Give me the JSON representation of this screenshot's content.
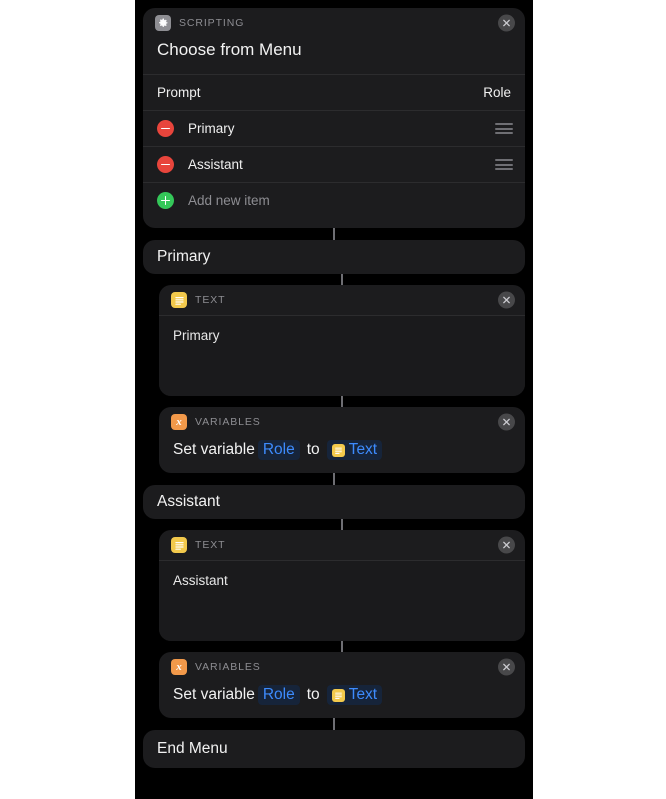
{
  "app": {
    "background": "#000000",
    "page_background": "#ffffff"
  },
  "colors": {
    "card": "#1c1c1e",
    "scripting_icon": "#8e8e93",
    "text_icon": "#f2c94c",
    "variables_icon": "#f2994a",
    "remove": "#e8453c",
    "add": "#34c759",
    "token_text": "#3d8bfd",
    "token_background": "#16243a",
    "separator": "#2c2c2e",
    "connector": "#6e6e73"
  },
  "choose_from_menu": {
    "category": "SCRIPTING",
    "category_icon": "gear-icon",
    "title": "Choose from Menu",
    "close_label": "×",
    "prompt": {
      "label": "Prompt",
      "value": "Role"
    },
    "menu_items": [
      {
        "label": "Primary",
        "remove_icon": "minus-circle-icon",
        "handle_icon": "drag-handle-icon"
      },
      {
        "label": "Assistant",
        "remove_icon": "minus-circle-icon",
        "handle_icon": "drag-handle-icon"
      }
    ],
    "add_new_item": {
      "label": "Add new item",
      "add_icon": "plus-circle-icon"
    }
  },
  "branches": [
    {
      "header": "Primary",
      "text_block": {
        "category": "TEXT",
        "category_icon": "text-document-icon",
        "content": "Primary",
        "close_label": "×"
      },
      "variable_block": {
        "category": "VARIABLES",
        "category_icon": "variable-x-icon",
        "close_label": "×",
        "prefix": "Set variable",
        "variable_token": "Role",
        "connector_word": "to",
        "value_token": "Text",
        "value_token_icon": "text-document-icon"
      }
    },
    {
      "header": "Assistant",
      "text_block": {
        "category": "TEXT",
        "category_icon": "text-document-icon",
        "content": "Assistant",
        "close_label": "×"
      },
      "variable_block": {
        "category": "VARIABLES",
        "category_icon": "variable-x-icon",
        "close_label": "×",
        "prefix": "Set variable",
        "variable_token": "Role",
        "connector_word": "to",
        "value_token": "Text",
        "value_token_icon": "text-document-icon"
      }
    }
  ],
  "end_menu": {
    "label": "End Menu"
  }
}
